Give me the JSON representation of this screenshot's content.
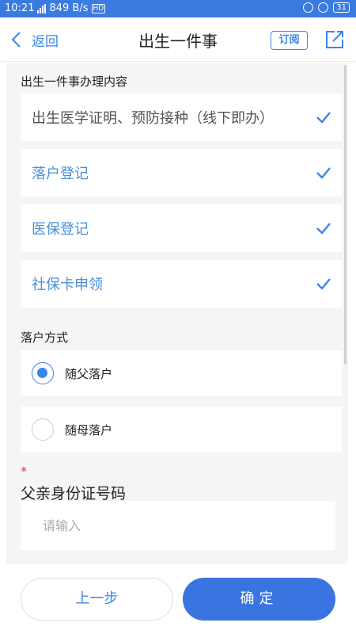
{
  "statusbar": {
    "time": "10:21",
    "net_speed": "849 B/s",
    "hd": "HD",
    "battery": "31"
  },
  "nav": {
    "back_label": "返回",
    "title": "出生一件事",
    "subscribe_label": "订阅"
  },
  "handling": {
    "section_label": "出生一件事办理内容",
    "items": [
      {
        "label": "出生医学证明、预防接种（线下即办）",
        "checked": true
      },
      {
        "label": "落户登记",
        "checked": true
      },
      {
        "label": "医保登记",
        "checked": true
      },
      {
        "label": "社保卡申领",
        "checked": true
      }
    ]
  },
  "settle": {
    "section_label": "落户方式",
    "options": [
      {
        "label": "随父落户",
        "selected": true
      },
      {
        "label": "随母落户",
        "selected": false
      }
    ]
  },
  "father_id": {
    "required_mark": "*",
    "label": "父亲身份证号码",
    "placeholder": "请输入",
    "value": ""
  },
  "footer": {
    "prev_label": "上一步",
    "confirm_label": "确定"
  },
  "colors": {
    "accent": "#3a86e8",
    "statusbar": "#3a7be0",
    "required": "#e53935"
  }
}
